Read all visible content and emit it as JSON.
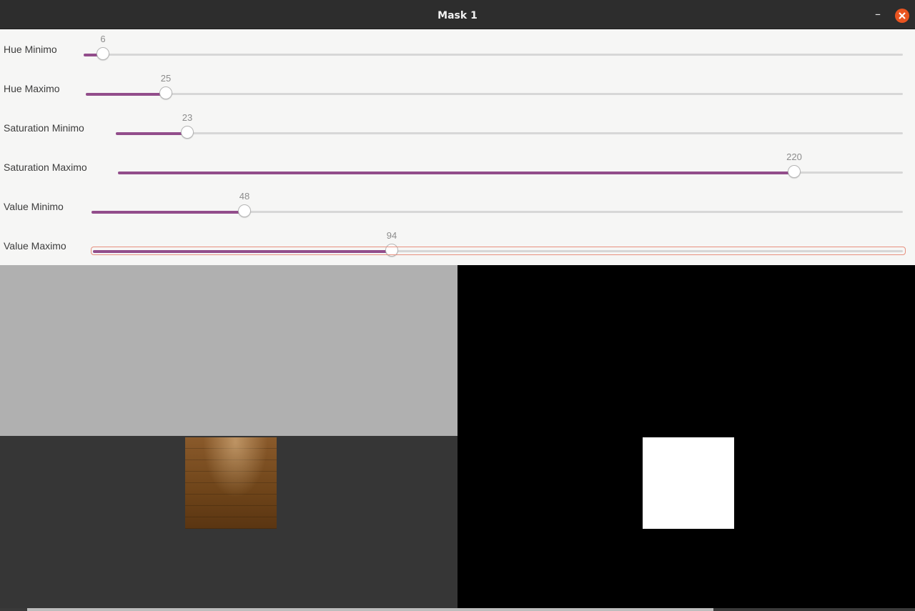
{
  "window": {
    "title": "Mask 1"
  },
  "sliders": [
    {
      "label": "Hue Minimo",
      "value": "6",
      "fraction": 0.0235
    },
    {
      "label": "Hue Maximo",
      "value": "25",
      "fraction": 0.098
    },
    {
      "label": "Saturation Minimo",
      "value": "23",
      "fraction": 0.09
    },
    {
      "label": "Saturation Maximo",
      "value": "220",
      "fraction": 0.8627
    },
    {
      "label": "Value Minimo",
      "value": "48",
      "fraction": 0.188
    },
    {
      "label": "Value Maximo",
      "value": "94",
      "fraction": 0.3686
    }
  ],
  "colors": {
    "accent": "#924d8b",
    "close": "#e95420",
    "focus": "#e7907e"
  }
}
